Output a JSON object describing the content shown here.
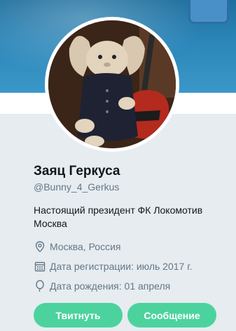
{
  "profile": {
    "name": "Заяц Геркуса",
    "handle": "@Bunny_4_Gerkus",
    "bio": "Настоящий президент ФК Локомотив Москва",
    "location": "Москва, Россия",
    "joined": "Дата регистрации: июль 2017 г.",
    "birthday": "Дата рождения: 01 апреля"
  },
  "actions": {
    "tweet_label": "Твитнуть",
    "message_label": "Сообщение"
  },
  "icons": {
    "location": "location-pin-icon",
    "joined": "calendar-icon",
    "birthday": "balloon-icon"
  },
  "colors": {
    "button": "#4cd39d",
    "meta_text": "#657786",
    "panel_bg": "#e6ecf0"
  }
}
